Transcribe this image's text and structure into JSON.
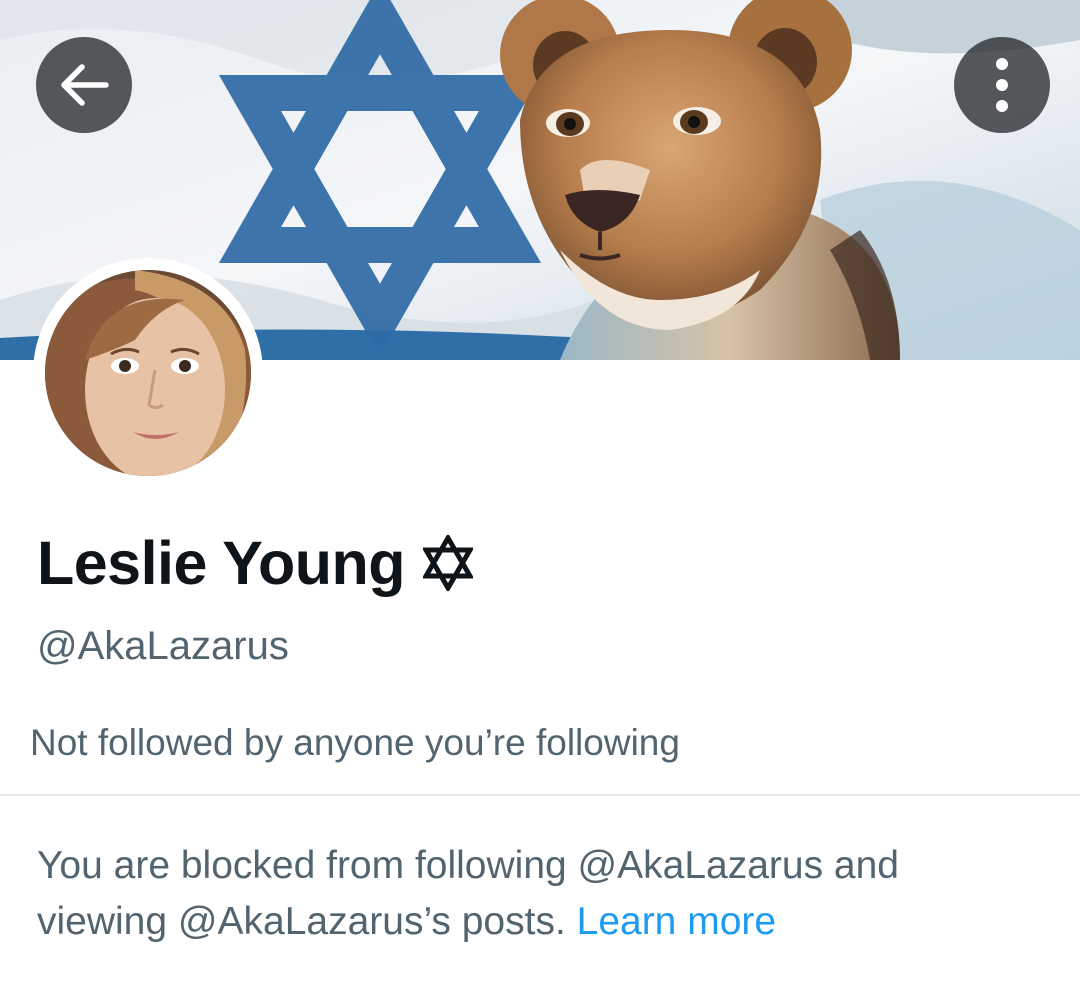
{
  "header": {
    "back_icon": "arrow-left-icon",
    "more_icon": "more-vertical-icon",
    "banner": "Israeli flag with lioness"
  },
  "profile": {
    "display_name": "Leslie Young",
    "name_emoji_icon": "star-of-david-icon",
    "handle": "@AkaLazarus",
    "followers_note": "Not followed by anyone you’re following"
  },
  "blocked_notice": {
    "text": "You are blocked from following @AkaLazarus and viewing @AkaLazarus’s posts.",
    "link_label": "Learn more"
  },
  "colors": {
    "primary_text": "#0f1419",
    "secondary_text": "#536471",
    "link": "#1d9bf0",
    "divider": "#e6e9ea"
  }
}
